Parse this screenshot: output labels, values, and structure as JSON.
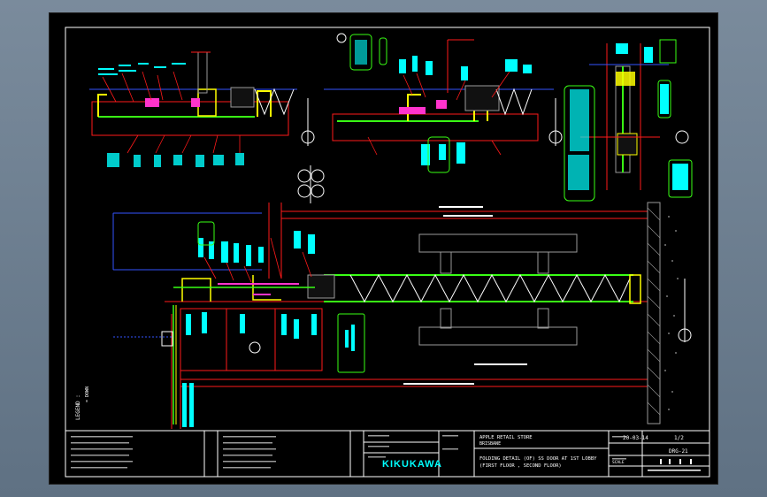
{
  "viewport": {
    "background": "#6f8192"
  },
  "drawing": {
    "colors": {
      "frame": "#ffffff",
      "red": "#ff1a1a",
      "green": "#39ff14",
      "yellow": "#ffff00",
      "cyan": "#00ffff",
      "magenta": "#ff33cc",
      "blue": "#3355ff",
      "white": "#ffffff",
      "gray": "#9a9a9a"
    },
    "title_block": {
      "logo": "KIKUKAWA",
      "project": "APPLE RETAIL STORE",
      "project_line2": "BRISBANE",
      "drawing_title_1": "FOLDING DETAIL (OF) SS DOOR AT 1ST LOBBY",
      "drawing_title_2": "(FIRST FLOOR , SECOND FLOOR)",
      "date": "20-03-14",
      "sheet": "1/2",
      "scale_label": "SCALE",
      "drawing_no": "DRG-21"
    },
    "legend_title": "LEGEND :",
    "legend_item": "= DOWN"
  }
}
